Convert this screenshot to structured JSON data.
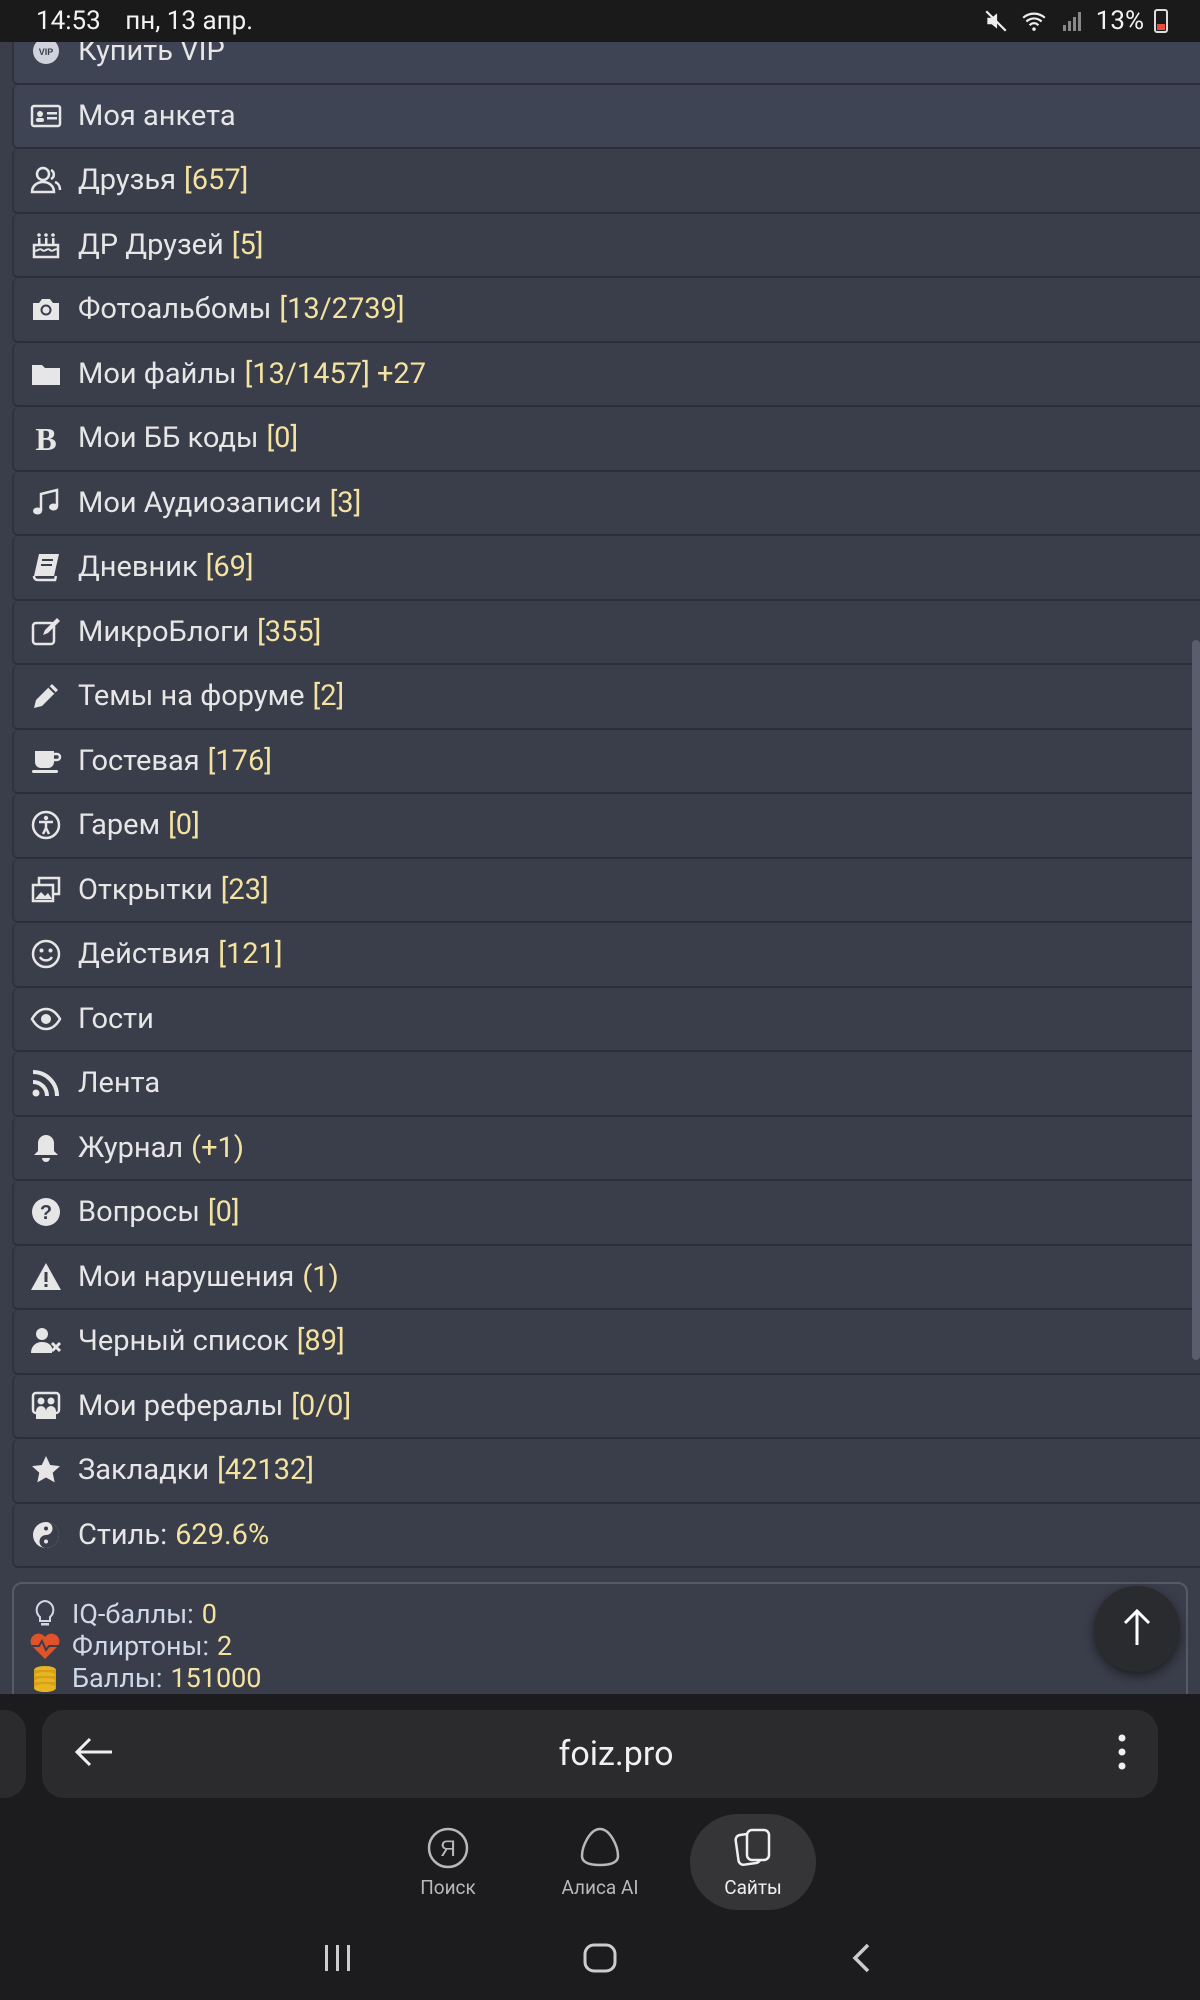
{
  "status_bar": {
    "time": "14:53",
    "date": "пн, 13 апр.",
    "battery": "13%"
  },
  "menu": {
    "items": [
      {
        "label": "Купить VIP",
        "count": "",
        "icon": "vip-icon",
        "highlight": true
      },
      {
        "label": "Моя анкета",
        "count": "",
        "icon": "id-card-icon",
        "highlight": true
      },
      {
        "label": "Друзья",
        "count": "[657]",
        "icon": "user-friends-icon"
      },
      {
        "label": "ДР Друзей",
        "count": "[5]",
        "icon": "birthday-cake-icon"
      },
      {
        "label": "Фотоальбомы",
        "count": "[13/2739]",
        "icon": "camera-icon"
      },
      {
        "label": "Мои файлы",
        "count": "[13/1457] +27",
        "icon": "folder-icon"
      },
      {
        "label": "Мои ББ коды",
        "count": "[0]",
        "icon": "bold-b-icon"
      },
      {
        "label": "Мои Аудиозаписи",
        "count": "[3]",
        "icon": "music-note-icon"
      },
      {
        "label": "Дневник",
        "count": "[69]",
        "icon": "book-icon"
      },
      {
        "label": "МикроБлоги",
        "count": "[355]",
        "icon": "edit-icon"
      },
      {
        "label": "Темы на форуме",
        "count": "[2]",
        "icon": "pencil-icon"
      },
      {
        "label": "Гостевая",
        "count": "[176]",
        "icon": "coffee-cup-icon"
      },
      {
        "label": "Гарем",
        "count": "[0]",
        "icon": "accessibility-icon"
      },
      {
        "label": "Открытки",
        "count": "[23]",
        "icon": "images-icon"
      },
      {
        "label": "Действия",
        "count": "[121]",
        "icon": "smile-icon"
      },
      {
        "label": "Гости",
        "count": "",
        "icon": "eye-icon"
      },
      {
        "label": "Лента",
        "count": "",
        "icon": "rss-icon"
      },
      {
        "label": "Журнал",
        "count": "(+1)",
        "icon": "bell-icon"
      },
      {
        "label": "Вопросы",
        "count": "[0]",
        "icon": "question-circle-icon"
      },
      {
        "label": "Мои нарушения",
        "count": "(1)",
        "icon": "warning-icon"
      },
      {
        "label": "Черный список",
        "count": "[89]",
        "icon": "user-block-icon"
      },
      {
        "label": "Мои рефералы",
        "count": "[0/0]",
        "icon": "referrals-icon"
      },
      {
        "label": "Закладки",
        "count": "[42132]",
        "icon": "star-icon"
      },
      {
        "label": "Стиль:",
        "count": "629.6%",
        "icon": "yin-yang-icon"
      }
    ]
  },
  "stats": {
    "iq_label": "IQ-баллы:",
    "iq_value": "0",
    "flirt_label": "Флиртоны:",
    "flirt_value": "2",
    "points_label": "Баллы:",
    "points_value": "151000"
  },
  "browser": {
    "url": "foiz.pro"
  },
  "tabs": [
    {
      "label": "Поиск",
      "icon": "yandex-icon"
    },
    {
      "label": "Алиса AI",
      "icon": "alice-icon"
    },
    {
      "label": "Сайты",
      "icon": "sites-icon",
      "active": true
    }
  ],
  "colors": {
    "background": "#3a3d4a",
    "count_text": "#f4e3a0",
    "item_text": "#e6e6e6"
  }
}
